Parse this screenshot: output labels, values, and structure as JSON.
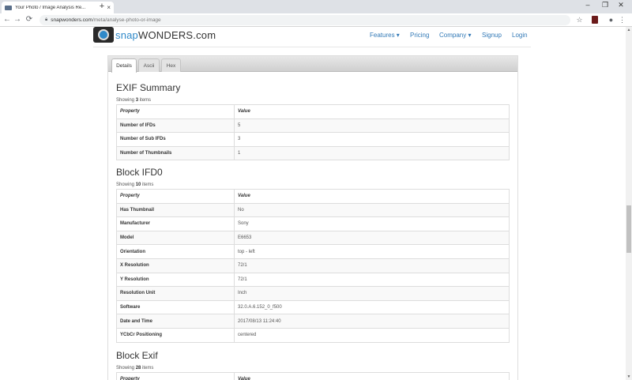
{
  "browser": {
    "tab_title": "Your Photo / Image Analysis Re...",
    "tab_close": "×",
    "new_tab": "+",
    "url_host": "snapwonders.com",
    "url_path": "/meta/analyse-photo-or-image",
    "win_minimize": "–",
    "win_restore": "❐",
    "win_close": "✕"
  },
  "site": {
    "brand_snap": "snap",
    "brand_rest": "WONDERS.com",
    "nav": {
      "features": "Features ▾",
      "pricing": "Pricing",
      "company": "Company ▾",
      "signup": "Signup",
      "login": "Login"
    }
  },
  "panel_tabs": {
    "details": "Details",
    "ascii": "Ascii",
    "hex": "Hex"
  },
  "exif_summary": {
    "title": "EXIF Summary",
    "showing_prefix": "Showing ",
    "count": "3",
    "showing_suffix": " items",
    "header_property": "Property",
    "header_value": "Value",
    "rows": [
      {
        "property": "Number of IFDs",
        "value": "5"
      },
      {
        "property": "Number of Sub IFDs",
        "value": "3"
      },
      {
        "property": "Number of Thumbnails",
        "value": "1"
      }
    ]
  },
  "block_ifd0": {
    "title": "Block IFD0",
    "showing_prefix": "Showing ",
    "count": "10",
    "showing_suffix": " items",
    "header_property": "Property",
    "header_value": "Value",
    "rows": [
      {
        "property": "Has Thumbnail",
        "value": "No"
      },
      {
        "property": "Manufacturer",
        "value": "Sony"
      },
      {
        "property": "Model",
        "value": "E6653"
      },
      {
        "property": "Orientation",
        "value": "top - left"
      },
      {
        "property": "X Resolution",
        "value": "72/1"
      },
      {
        "property": "Y Resolution",
        "value": "72/1"
      },
      {
        "property": "Resolution Unit",
        "value": "Inch"
      },
      {
        "property": "Software",
        "value": "32.0.A.6.152_0_f500"
      },
      {
        "property": "Date and Time",
        "value": "2017/08/13 11:24:40"
      },
      {
        "property": "YCbCr Positioning",
        "value": "centered"
      }
    ]
  },
  "block_exif": {
    "title": "Block Exif",
    "showing_prefix": "Showing ",
    "count": "28",
    "showing_suffix": " items",
    "header_property": "Property",
    "header_value": "Value"
  }
}
